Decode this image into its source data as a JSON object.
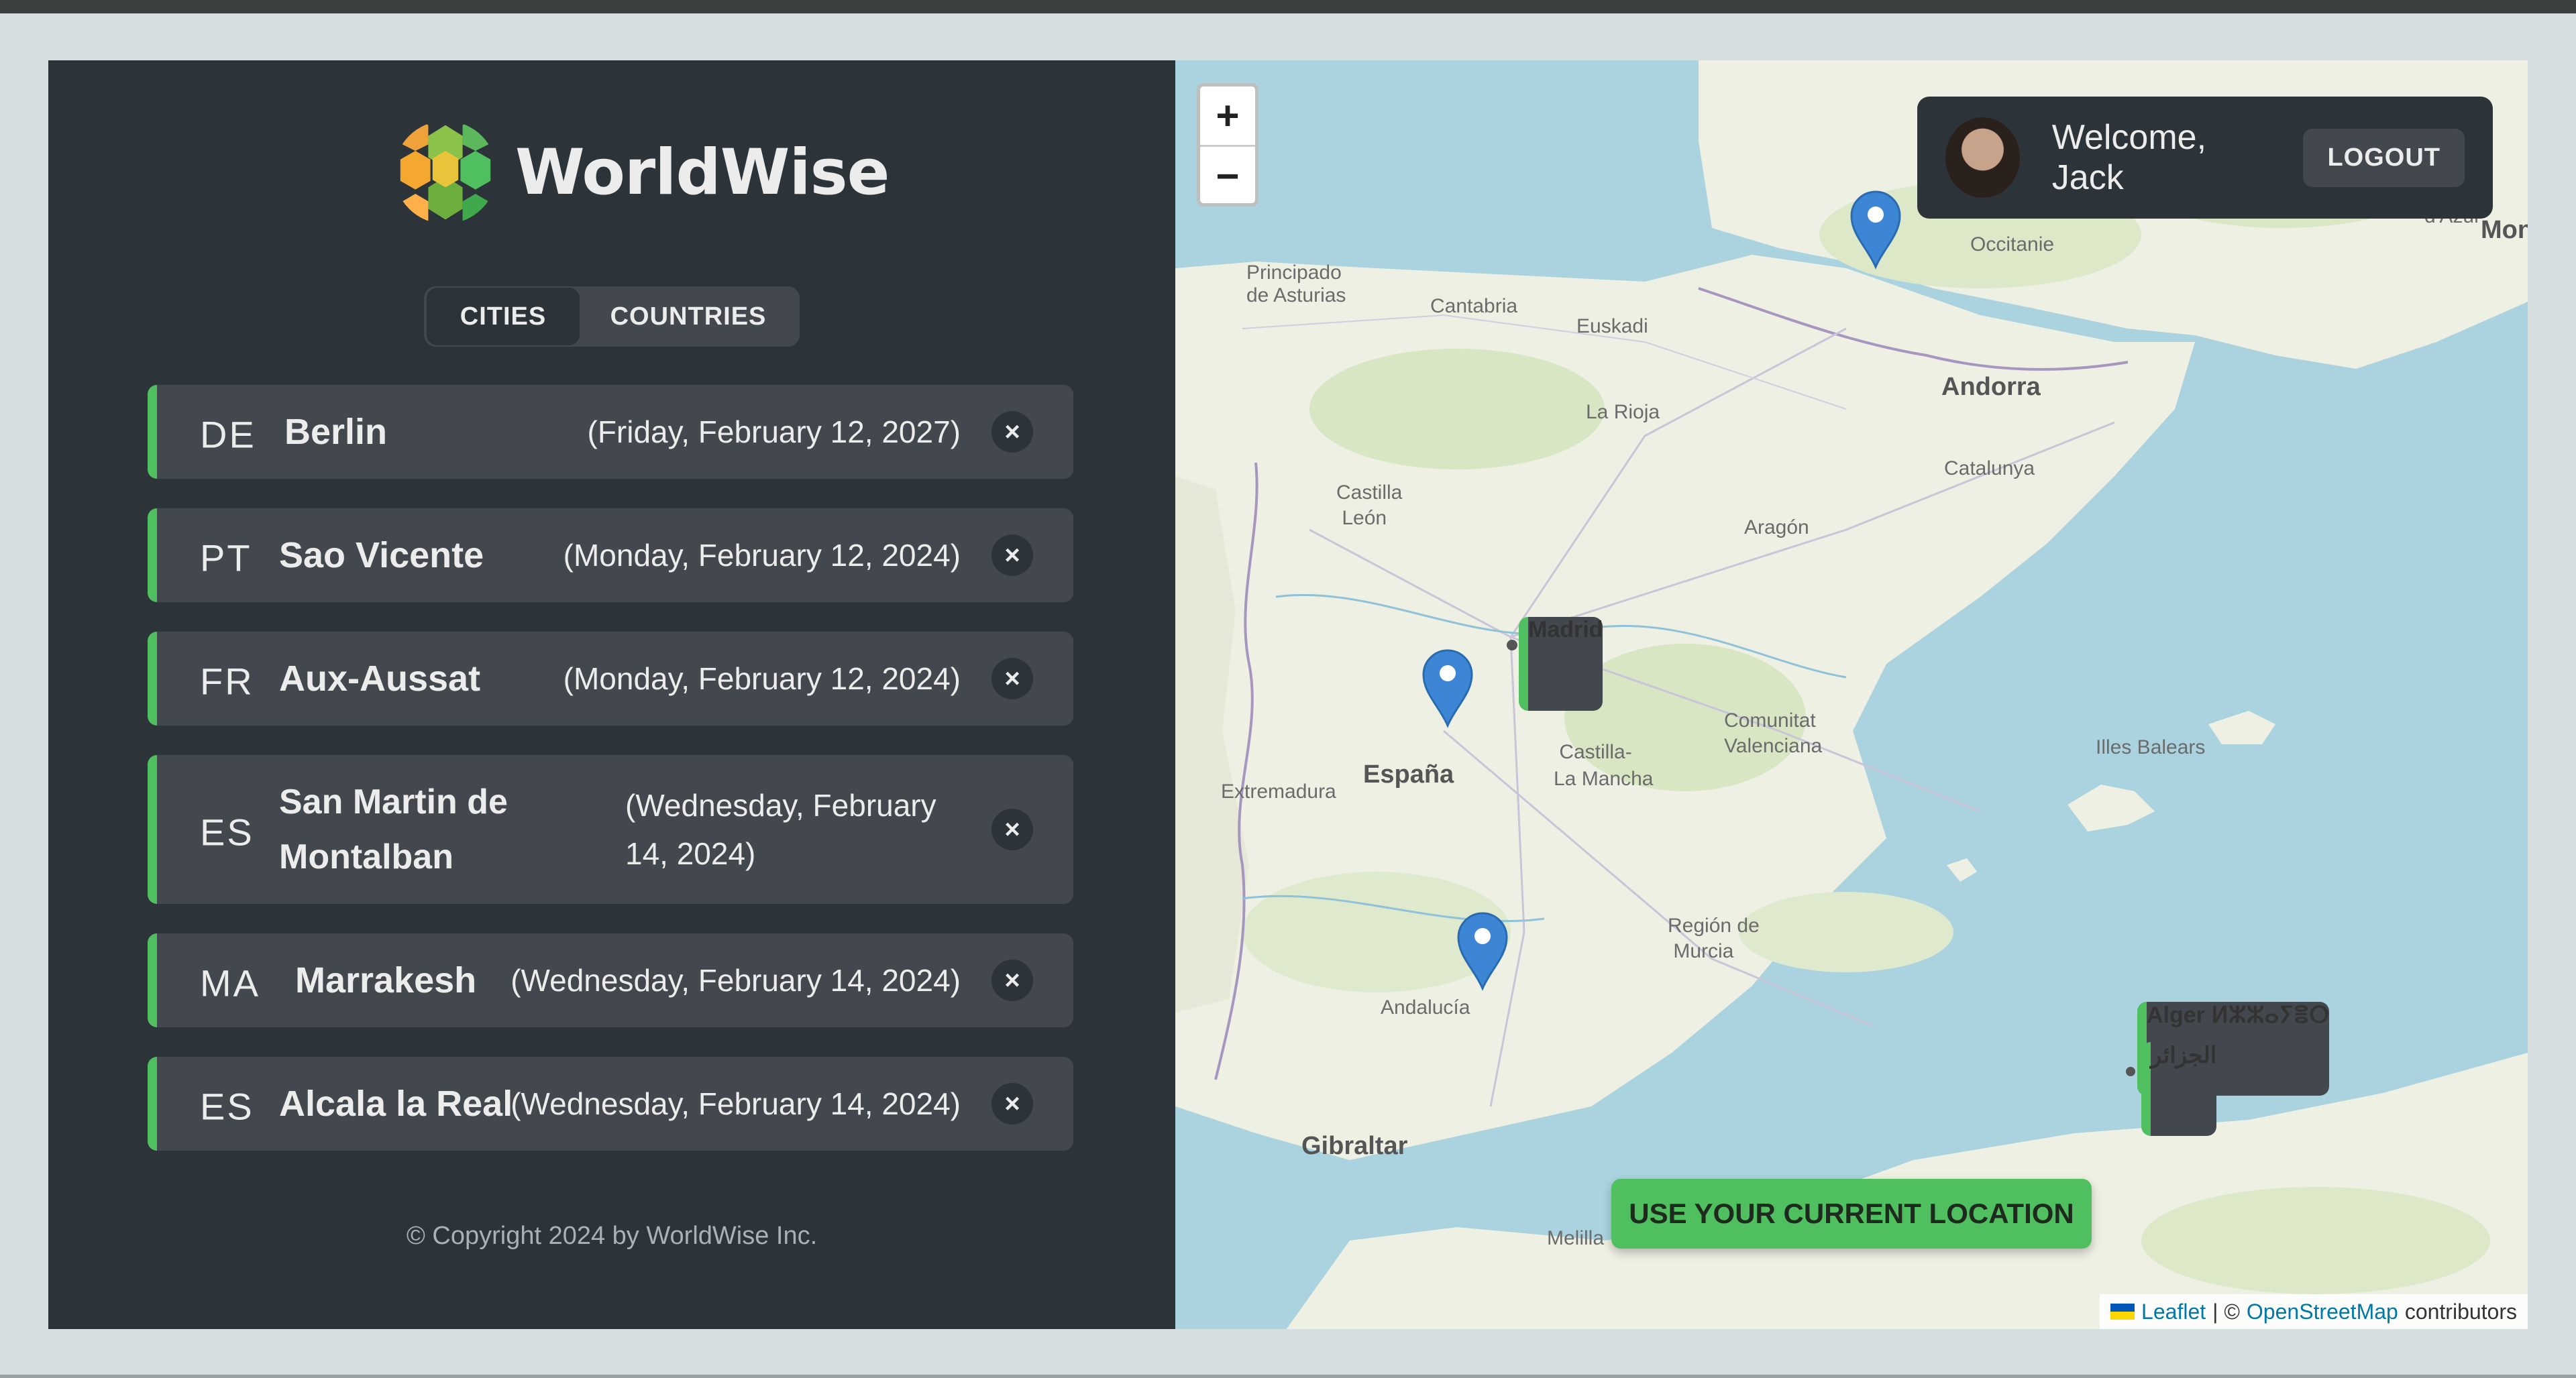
{
  "app": {
    "name": "WorldWise",
    "copyright": "© Copyright 2024 by WorldWise Inc."
  },
  "tabs": [
    {
      "label": "CITIES",
      "active": true
    },
    {
      "label": "COUNTRIES",
      "active": false
    }
  ],
  "cities": [
    {
      "code": "DE",
      "name": "Berlin",
      "date": "(Friday, February 12, 2027)",
      "delete": "×"
    },
    {
      "code": "PT",
      "name": "Sao Vicente",
      "date": "(Monday, February 12, 2024)",
      "delete": "×"
    },
    {
      "code": "FR",
      "name": "Aux-Aussat",
      "date": "(Monday, February 12, 2024)",
      "delete": "×"
    },
    {
      "code": "ES",
      "name": "San Martin de Montalban",
      "date": "(Wednesday, February 14, 2024)",
      "delete": "×"
    },
    {
      "code": "MA",
      "name": "Marrakesh",
      "date": "(Wednesday, February 14, 2024)",
      "delete": "×"
    },
    {
      "code": "ES",
      "name": "Alcala la Real",
      "date": "(Wednesday, February 14, 2024)",
      "delete": "×"
    }
  ],
  "map": {
    "zoom_in": "+",
    "zoom_out": "−",
    "user": {
      "welcome": "Welcome, Jack",
      "logout": "LOGOUT"
    },
    "locate_button": "USE YOUR CURRENT LOCATION",
    "attribution": {
      "leaflet": "Leaflet",
      "sep": "| ©",
      "osm": "OpenStreetMap",
      "contributors": "contributors"
    },
    "labels": {
      "principado": "Principado\nde Asturias",
      "cantabria": "Cantabria",
      "euskadi": "Euskadi",
      "occitanie": "Occitanie",
      "azur": "d'Azur",
      "mon": "Mon",
      "andorra": "Andorra",
      "larioja": "La Rioja",
      "catalunya": "Catalunya",
      "castilla_leon": "Castilla\nLeón",
      "aragon": "Aragón",
      "madrid": "Madrid",
      "comunitat": "Comunitat\nValenciana",
      "illes": "Illes Balears",
      "espana": "España",
      "castilla_mancha": "Castilla-\nLa Mancha",
      "extremadura": "Extremadura",
      "murcia": "Región de\nMurcia",
      "andalucia": "Andalucía",
      "alger": "Alger ⵍⵣⵣⴰⵢⴻⵔ",
      "aljazair": "الجزائر",
      "gibraltar": "Gibraltar",
      "melilla": "Melilla"
    }
  },
  "colors": {
    "sidebar_bg": "#2d3439",
    "card_bg": "#42484d",
    "accent_green": "#4fbf5f",
    "text": "#ececec",
    "marker_blue": "#3d86d6"
  }
}
